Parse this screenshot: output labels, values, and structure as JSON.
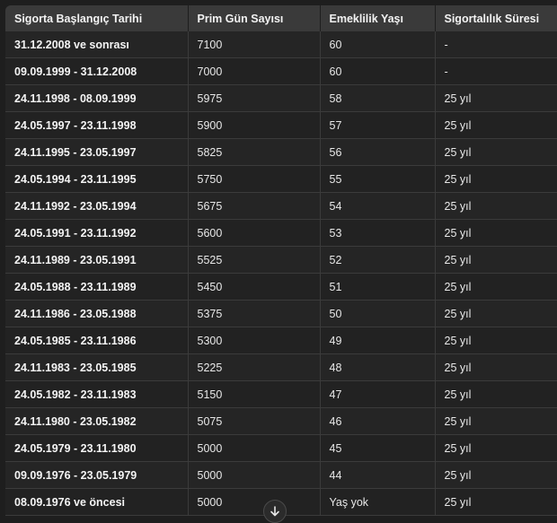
{
  "table": {
    "headers": [
      "Sigorta Başlangıç Tarihi",
      "Prim Gün Sayısı",
      "Emeklilik Yaşı",
      "Sigortalılık Süresi"
    ],
    "rows": [
      [
        "31.12.2008 ve sonrası",
        "7100",
        "60",
        "-"
      ],
      [
        "09.09.1999 - 31.12.2008",
        "7000",
        "60",
        "-"
      ],
      [
        "24.11.1998 - 08.09.1999",
        "5975",
        "58",
        "25 yıl"
      ],
      [
        "24.05.1997 - 23.11.1998",
        "5900",
        "57",
        "25 yıl"
      ],
      [
        "24.11.1995 - 23.05.1997",
        "5825",
        "56",
        "25 yıl"
      ],
      [
        "24.05.1994 - 23.11.1995",
        "5750",
        "55",
        "25 yıl"
      ],
      [
        "24.11.1992 - 23.05.1994",
        "5675",
        "54",
        "25 yıl"
      ],
      [
        "24.05.1991 - 23.11.1992",
        "5600",
        "53",
        "25 yıl"
      ],
      [
        "24.11.1989 - 23.05.1991",
        "5525",
        "52",
        "25 yıl"
      ],
      [
        "24.05.1988 - 23.11.1989",
        "5450",
        "51",
        "25 yıl"
      ],
      [
        "24.11.1986 - 23.05.1988",
        "5375",
        "50",
        "25 yıl"
      ],
      [
        "24.05.1985 - 23.11.1986",
        "5300",
        "49",
        "25 yıl"
      ],
      [
        "24.11.1983 - 23.05.1985",
        "5225",
        "48",
        "25 yıl"
      ],
      [
        "24.05.1982 - 23.11.1983",
        "5150",
        "47",
        "25 yıl"
      ],
      [
        "24.11.1980 - 23.05.1982",
        "5075",
        "46",
        "25 yıl"
      ],
      [
        "24.05.1979 - 23.11.1980",
        "5000",
        "45",
        "25 yıl"
      ],
      [
        "09.09.1976 - 23.05.1979",
        "5000",
        "44",
        "25 yıl"
      ],
      [
        "08.09.1976 ve öncesi",
        "5000",
        "Yaş yok",
        "25 yıl"
      ]
    ]
  },
  "scroll_button": {
    "icon": "arrow-down-icon"
  }
}
